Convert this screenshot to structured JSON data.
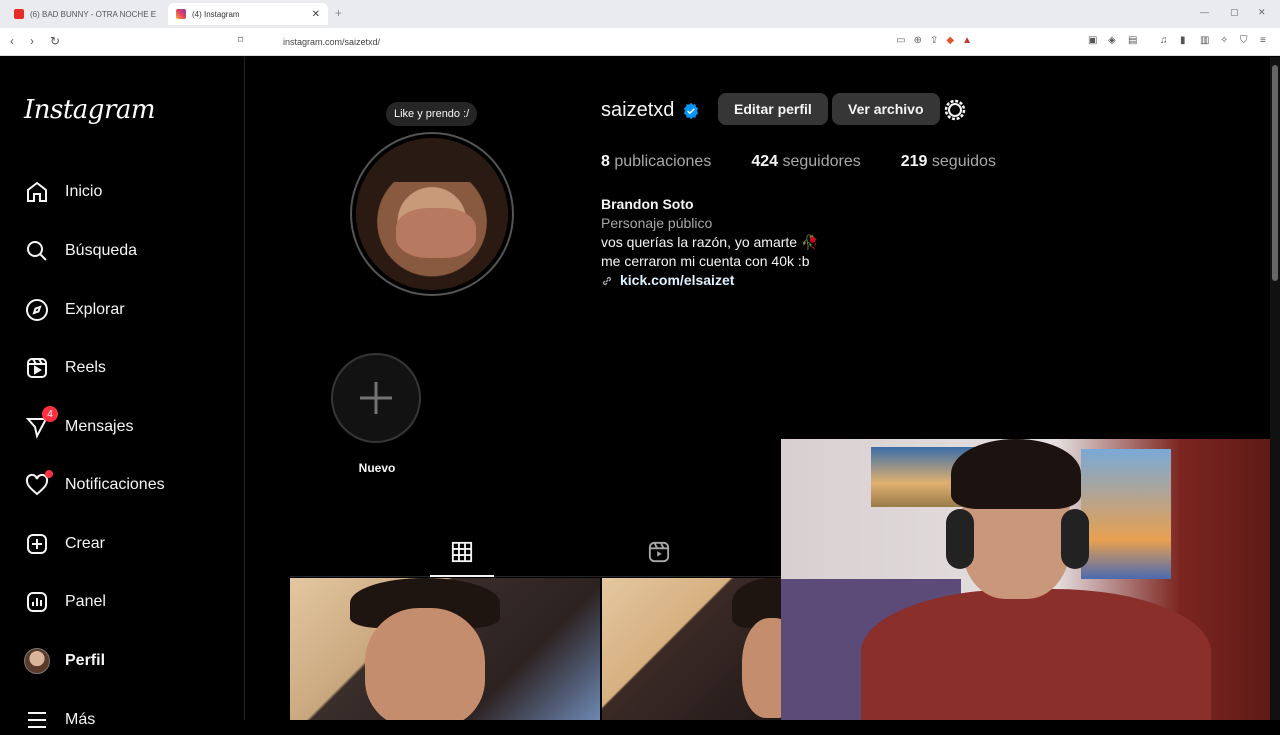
{
  "browser": {
    "tabs": [
      {
        "label": "(6) BAD BUNNY - OTRA NOCHE E",
        "active": false,
        "favicon": "youtube-icon"
      },
      {
        "label": "(4) Instagram",
        "active": true,
        "favicon": "instagram-icon"
      }
    ],
    "url": "instagram.com/saizetxd/"
  },
  "sidebar": {
    "logo": "Instagram",
    "items": [
      {
        "label": "Inicio",
        "icon": "home-icon"
      },
      {
        "label": "Búsqueda",
        "icon": "search-icon"
      },
      {
        "label": "Explorar",
        "icon": "compass-icon"
      },
      {
        "label": "Reels",
        "icon": "reels-icon"
      },
      {
        "label": "Mensajes",
        "icon": "messenger-icon",
        "badge": "4"
      },
      {
        "label": "Notificaciones",
        "icon": "heart-icon"
      },
      {
        "label": "Crear",
        "icon": "plus-square-icon"
      },
      {
        "label": "Panel",
        "icon": "chart-icon"
      },
      {
        "label": "Perfil",
        "icon": "avatar"
      },
      {
        "label": "Más",
        "icon": "menu-icon"
      }
    ]
  },
  "profile": {
    "note": "Like y prendo :/",
    "username": "saizetxd",
    "edit_button": "Editar perfil",
    "archive_button": "Ver archivo",
    "stats": {
      "posts_count": "8",
      "posts_label": "publicaciones",
      "followers_count": "424",
      "followers_label": "seguidores",
      "following_count": "219",
      "following_label": "seguidos"
    },
    "bio": {
      "name": "Brandon Soto",
      "category": "Personaje público",
      "line1": "vos querías la razón, yo amarte 🥀",
      "line2": "me cerraron mi cuenta con 40k :b",
      "link": "kick.com/elsaizet"
    },
    "highlight_new": "Nuevo"
  },
  "colors": {
    "background": "#000000",
    "button": "#363636",
    "verified": "#0095f6",
    "badge": "#ff3040"
  }
}
